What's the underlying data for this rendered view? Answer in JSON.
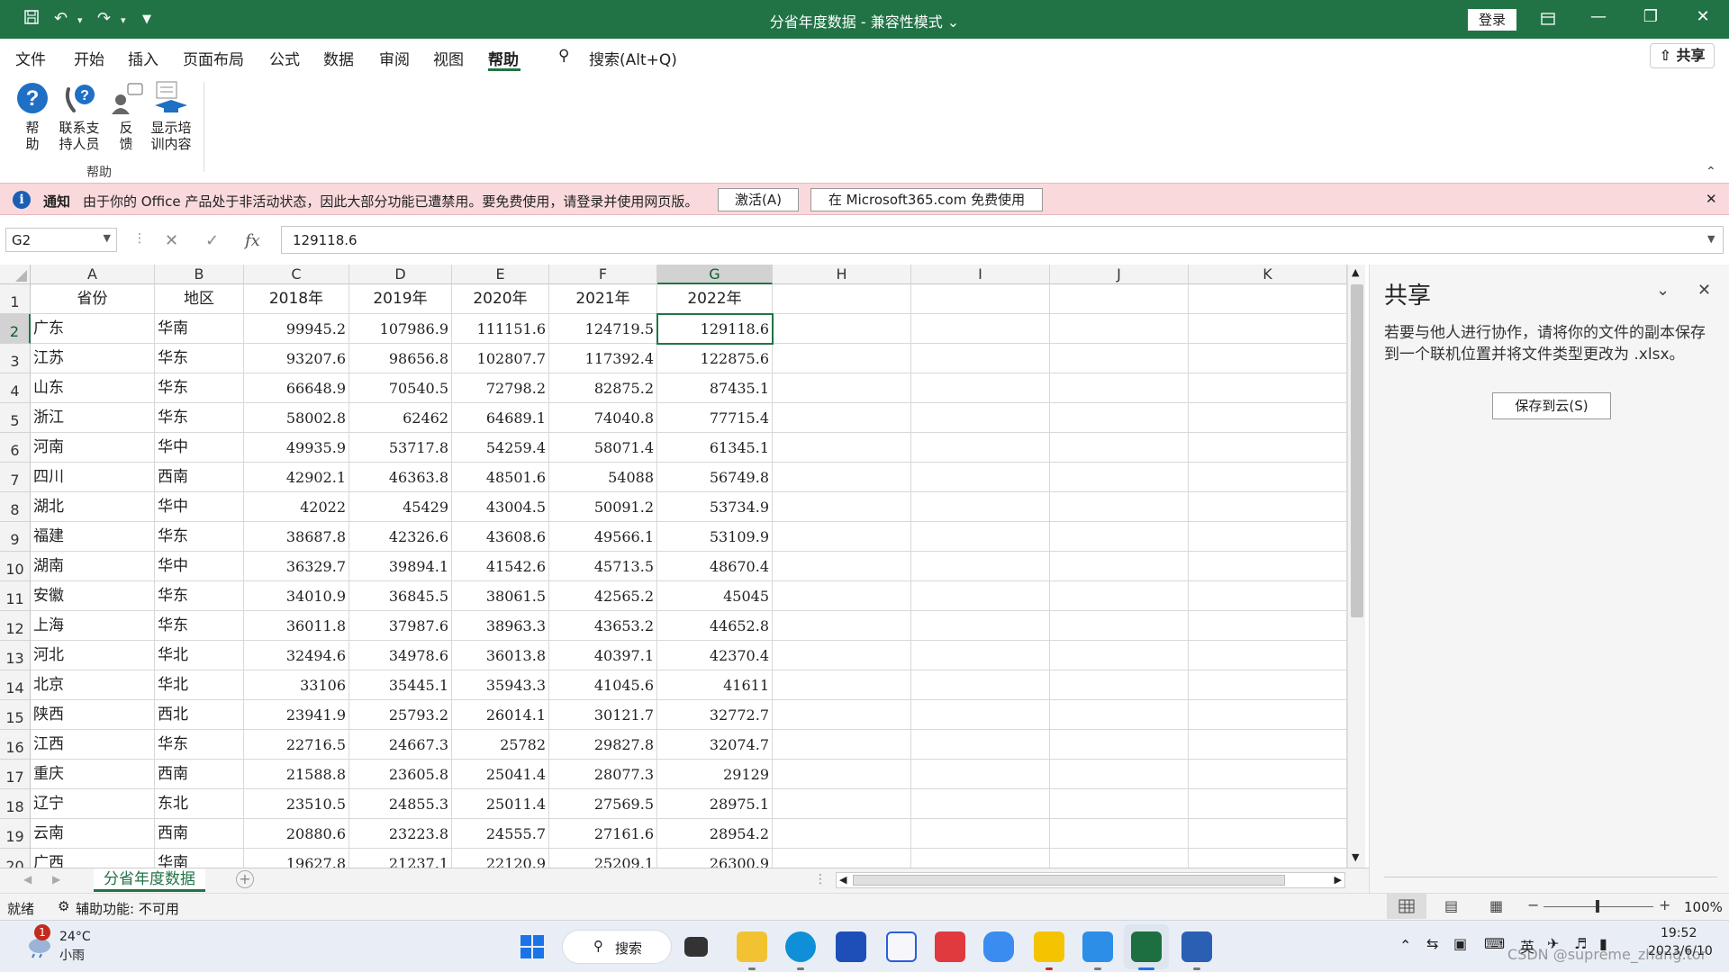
{
  "window": {
    "title": "分省年度数据  -  兼容性模式",
    "login": "登录"
  },
  "tabs": [
    "文件",
    "开始",
    "插入",
    "页面布局",
    "公式",
    "数据",
    "审阅",
    "视图",
    "帮助"
  ],
  "active_tab": "帮助",
  "search_label": "搜索(Alt+Q)",
  "share_label": "共享",
  "ribbon": {
    "buttons": [
      {
        "l1": "帮",
        "l2": "助",
        "icon": "help-icon"
      },
      {
        "l1": "联系支",
        "l2": "持人员",
        "icon": "support-icon"
      },
      {
        "l1": "反",
        "l2": "馈",
        "icon": "feedback-icon"
      },
      {
        "l1": "显示培",
        "l2": "训内容",
        "icon": "training-icon"
      }
    ],
    "group_label": "帮助"
  },
  "notice": {
    "label": "通知",
    "message": "由于你的 Office 产品处于非活动状态，因此大部分功能已遭禁用。要免费使用，请登录并使用网页版。",
    "activate_button": "激活(A)",
    "free_button": "在 Microsoft365.com 免费使用"
  },
  "formula_bar": {
    "name_box": "G2",
    "value": "129118.6"
  },
  "columns": [
    "A",
    "B",
    "C",
    "D",
    "E",
    "F",
    "G",
    "H",
    "I",
    "J",
    "K"
  ],
  "selected_column": "G",
  "row_numbers": [
    "1",
    "2",
    "3",
    "4",
    "5",
    "6",
    "7",
    "8",
    "9",
    "10",
    "11",
    "12",
    "13",
    "14",
    "15",
    "16",
    "17",
    "18",
    "19",
    "20"
  ],
  "header_row": [
    "省份",
    "地区",
    "2018年",
    "2019年",
    "2020年",
    "2021年",
    "2022年"
  ],
  "rows": [
    [
      "广东",
      "华南",
      "99945.2",
      "107986.9",
      "111151.6",
      "124719.5",
      "129118.6"
    ],
    [
      "江苏",
      "华东",
      "93207.6",
      "98656.8",
      "102807.7",
      "117392.4",
      "122875.6"
    ],
    [
      "山东",
      "华东",
      "66648.9",
      "70540.5",
      "72798.2",
      "82875.2",
      "87435.1"
    ],
    [
      "浙江",
      "华东",
      "58002.8",
      "62462",
      "64689.1",
      "74040.8",
      "77715.4"
    ],
    [
      "河南",
      "华中",
      "49935.9",
      "53717.8",
      "54259.4",
      "58071.4",
      "61345.1"
    ],
    [
      "四川",
      "西南",
      "42902.1",
      "46363.8",
      "48501.6",
      "54088",
      "56749.8"
    ],
    [
      "湖北",
      "华中",
      "42022",
      "45429",
      "43004.5",
      "50091.2",
      "53734.9"
    ],
    [
      "福建",
      "华东",
      "38687.8",
      "42326.6",
      "43608.6",
      "49566.1",
      "53109.9"
    ],
    [
      "湖南",
      "华中",
      "36329.7",
      "39894.1",
      "41542.6",
      "45713.5",
      "48670.4"
    ],
    [
      "安徽",
      "华东",
      "34010.9",
      "36845.5",
      "38061.5",
      "42565.2",
      "45045"
    ],
    [
      "上海",
      "华东",
      "36011.8",
      "37987.6",
      "38963.3",
      "43653.2",
      "44652.8"
    ],
    [
      "河北",
      "华北",
      "32494.6",
      "34978.6",
      "36013.8",
      "40397.1",
      "42370.4"
    ],
    [
      "北京",
      "华北",
      "33106",
      "35445.1",
      "35943.3",
      "41045.6",
      "41611"
    ],
    [
      "陕西",
      "西北",
      "23941.9",
      "25793.2",
      "26014.1",
      "30121.7",
      "32772.7"
    ],
    [
      "江西",
      "华东",
      "22716.5",
      "24667.3",
      "25782",
      "29827.8",
      "32074.7"
    ],
    [
      "重庆",
      "西南",
      "21588.8",
      "23605.8",
      "25041.4",
      "28077.3",
      "29129"
    ],
    [
      "辽宁",
      "东北",
      "23510.5",
      "24855.3",
      "25011.4",
      "27569.5",
      "28975.1"
    ],
    [
      "云南",
      "西南",
      "20880.6",
      "23223.8",
      "24555.7",
      "27161.6",
      "28954.2"
    ],
    [
      "广西",
      "华南",
      "19627.8",
      "21237.1",
      "22120.9",
      "25209.1",
      "26300.9"
    ]
  ],
  "sheet_tab": "分省年度数据",
  "side_pane": {
    "title": "共享",
    "body": "若要与他人进行协作，请将你的文件的副本保存到一个联机位置并将文件类型更改为 .xlsx。",
    "save_button": "保存到云(S)"
  },
  "status": {
    "ready": "就绪",
    "accessibility": "辅助功能: 不可用",
    "zoom": "100%"
  },
  "taskbar": {
    "weather_temp": "24°C",
    "weather_desc": "小雨",
    "weather_badge": "1",
    "search": "搜索",
    "ime": "英",
    "time": "19:52",
    "date": "2023/6/10",
    "watermark": "CSDN @supreme_zhang.tor"
  },
  "colors": {
    "excel_green": "#217346",
    "notice_bg": "#f9d9dc"
  }
}
